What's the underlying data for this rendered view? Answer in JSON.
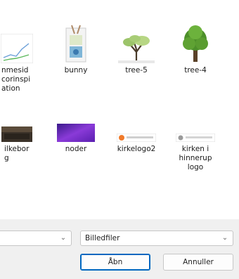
{
  "files": [
    {
      "name": "nmesid\ncorinspi\nation",
      "icon": "chart-image-icon"
    },
    {
      "name": "bunny",
      "icon": "bunny-image-icon"
    },
    {
      "name": "tree-5",
      "icon": "tree-image-icon"
    },
    {
      "name": "tree-4",
      "icon": "tree-image-icon"
    },
    {
      "name": "ilkebor\ng",
      "icon": "photo-image-icon"
    },
    {
      "name": "noder",
      "icon": "purple-image-icon"
    },
    {
      "name": "kirkelogo2",
      "icon": "logo-image-icon"
    },
    {
      "name": "kirken i\nhinnerup\nlogo",
      "icon": "logo-image-icon"
    }
  ],
  "filename_field": {
    "value": ""
  },
  "filetype_select": {
    "value": "Billedfiler"
  },
  "buttons": {
    "open": "Åbn",
    "cancel": "Annuller"
  },
  "colors": {
    "accent": "#0067c0",
    "bottom_bar": "#f0f0f0"
  }
}
